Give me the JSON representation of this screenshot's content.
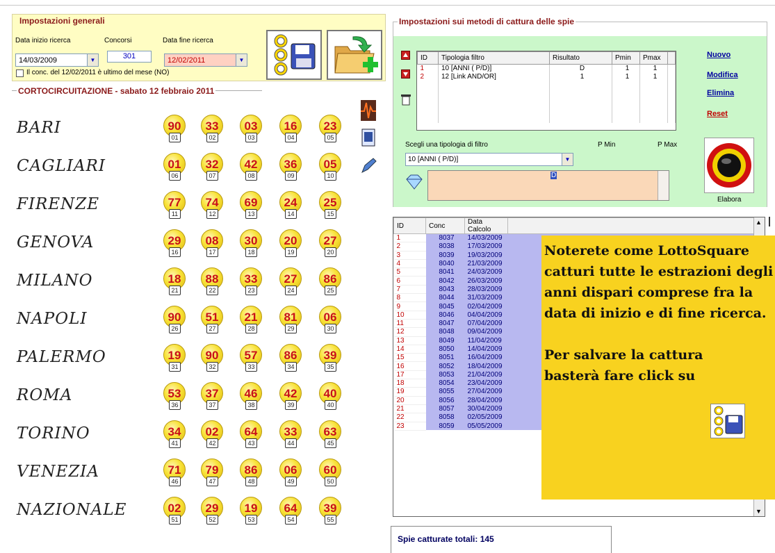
{
  "general": {
    "title": "Impostazioni generali",
    "start_label": "Data inizio ricerca",
    "concorsi_label": "Concorsi",
    "end_label": "Data fine ricerca",
    "start_date": "14/03/2009",
    "concorsi": "301",
    "end_date": "12/02/2011",
    "checkbox_label": "Il conc. del 12/02/2011 è ultimo del mese (NO)"
  },
  "extraction": {
    "title": "CORTOCIRCUITAZIONE - sabato 12 febbraio 2011",
    "rows": [
      {
        "city": "BARI",
        "n": [
          "90",
          "33",
          "03",
          "16",
          "23"
        ],
        "p": [
          "01",
          "02",
          "03",
          "04",
          "05"
        ]
      },
      {
        "city": "CAGLIARI",
        "n": [
          "01",
          "32",
          "42",
          "36",
          "05"
        ],
        "p": [
          "06",
          "07",
          "08",
          "09",
          "10"
        ]
      },
      {
        "city": "FIRENZE",
        "n": [
          "77",
          "74",
          "69",
          "24",
          "25"
        ],
        "p": [
          "11",
          "12",
          "13",
          "14",
          "15"
        ]
      },
      {
        "city": "GENOVA",
        "n": [
          "29",
          "08",
          "30",
          "20",
          "27"
        ],
        "p": [
          "16",
          "17",
          "18",
          "19",
          "20"
        ]
      },
      {
        "city": "MILANO",
        "n": [
          "18",
          "88",
          "33",
          "27",
          "86"
        ],
        "p": [
          "21",
          "22",
          "23",
          "24",
          "25"
        ]
      },
      {
        "city": "NAPOLI",
        "n": [
          "90",
          "51",
          "21",
          "81",
          "06"
        ],
        "p": [
          "26",
          "27",
          "28",
          "29",
          "30"
        ]
      },
      {
        "city": "PALERMO",
        "n": [
          "19",
          "90",
          "57",
          "86",
          "39"
        ],
        "p": [
          "31",
          "32",
          "33",
          "34",
          "35"
        ]
      },
      {
        "city": "ROMA",
        "n": [
          "53",
          "37",
          "46",
          "42",
          "40"
        ],
        "p": [
          "36",
          "37",
          "38",
          "39",
          "40"
        ]
      },
      {
        "city": "TORINO",
        "n": [
          "34",
          "02",
          "64",
          "33",
          "63"
        ],
        "p": [
          "41",
          "42",
          "43",
          "44",
          "45"
        ]
      },
      {
        "city": "VENEZIA",
        "n": [
          "71",
          "79",
          "86",
          "06",
          "60"
        ],
        "p": [
          "46",
          "47",
          "48",
          "49",
          "50"
        ]
      },
      {
        "city": "NAZIONALE",
        "n": [
          "02",
          "29",
          "19",
          "64",
          "39"
        ],
        "p": [
          "51",
          "52",
          "53",
          "54",
          "55"
        ]
      }
    ]
  },
  "methods": {
    "title": "Impostazioni sui metodi di cattura delle spie",
    "headers": [
      "ID",
      "Tipologia filtro",
      "Risultato",
      "Pmin",
      "Pmax"
    ],
    "rows": [
      [
        "1",
        "10 [ANNI ( P/D)]",
        "D",
        "1",
        "1"
      ],
      [
        "2",
        "12 [Link AND/OR]",
        "1",
        "1",
        "1"
      ]
    ],
    "links": {
      "nuovo": "Nuovo",
      "modifica": "Modifica",
      "elimina": "Elimina",
      "reset": "Reset"
    },
    "choose_label": "Scegli una tipologia di filtro",
    "pmin_label": "P Min",
    "pmax_label": "P Max",
    "filter_value": "10 [ANNI ( P/D)]",
    "result_value": "D",
    "elabora_label": "Elabora"
  },
  "list": {
    "headers": [
      "ID",
      "Conc",
      "Data Calcolo"
    ],
    "rows": [
      [
        "1",
        "8037",
        "14/03/2009"
      ],
      [
        "2",
        "8038",
        "17/03/2009"
      ],
      [
        "3",
        "8039",
        "19/03/2009"
      ],
      [
        "4",
        "8040",
        "21/03/2009"
      ],
      [
        "5",
        "8041",
        "24/03/2009"
      ],
      [
        "6",
        "8042",
        "26/03/2009"
      ],
      [
        "7",
        "8043",
        "28/03/2009"
      ],
      [
        "8",
        "8044",
        "31/03/2009"
      ],
      [
        "9",
        "8045",
        "02/04/2009"
      ],
      [
        "10",
        "8046",
        "04/04/2009"
      ],
      [
        "11",
        "8047",
        "07/04/2009"
      ],
      [
        "12",
        "8048",
        "09/04/2009"
      ],
      [
        "13",
        "8049",
        "11/04/2009"
      ],
      [
        "14",
        "8050",
        "14/04/2009"
      ],
      [
        "15",
        "8051",
        "16/04/2009"
      ],
      [
        "16",
        "8052",
        "18/04/2009"
      ],
      [
        "17",
        "8053",
        "21/04/2009"
      ],
      [
        "18",
        "8054",
        "23/04/2009"
      ],
      [
        "19",
        "8055",
        "27/04/2009"
      ],
      [
        "20",
        "8056",
        "28/04/2009"
      ],
      [
        "21",
        "8057",
        "30/04/2009"
      ],
      [
        "22",
        "8058",
        "02/05/2009"
      ],
      [
        "23",
        "8059",
        "05/05/2009"
      ]
    ]
  },
  "note": {
    "p1": "Noterete come LottoSquare catturi tutte le estrazioni degli anni dispari comprese fra la data di inizio e di fine ricerca.",
    "p2": "Per salvare la cattura basterà fare click su"
  },
  "status": {
    "total": "Spie catturate totali: 145"
  }
}
